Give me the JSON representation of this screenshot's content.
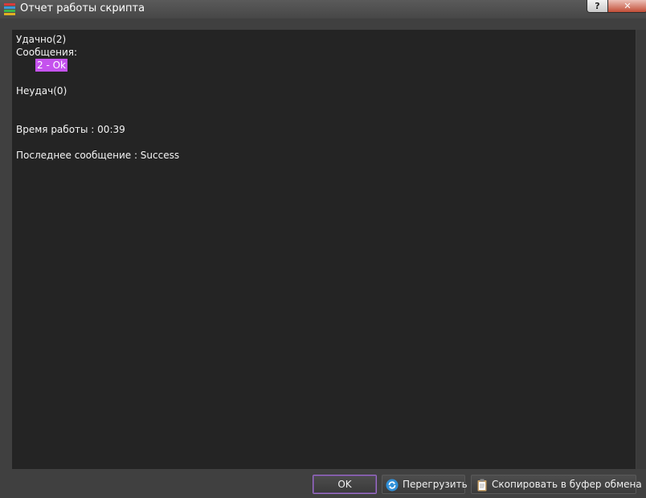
{
  "window": {
    "title": "Отчет работы скрипта",
    "help_label": "?",
    "close_label": "✕"
  },
  "report": {
    "success_heading": "Удачно(2)",
    "messages_label": "Сообщения:",
    "message_item": "2 - Ok",
    "fail_heading": "Неудач(0)",
    "run_time": "Время работы : 00:39",
    "last_message": "Последнее сообщение : Success"
  },
  "buttons": {
    "ok_label": "OK",
    "reload_label": "Перегрузить",
    "copy_label": "Скопировать в буфер обмена"
  },
  "icons": {
    "app": "stacked-books-icon",
    "reload": "refresh-icon",
    "copy": "clipboard-icon"
  },
  "colors": {
    "highlight": "#c552ee",
    "content_bg": "#242424",
    "ok_border": "#9b6fc6"
  }
}
